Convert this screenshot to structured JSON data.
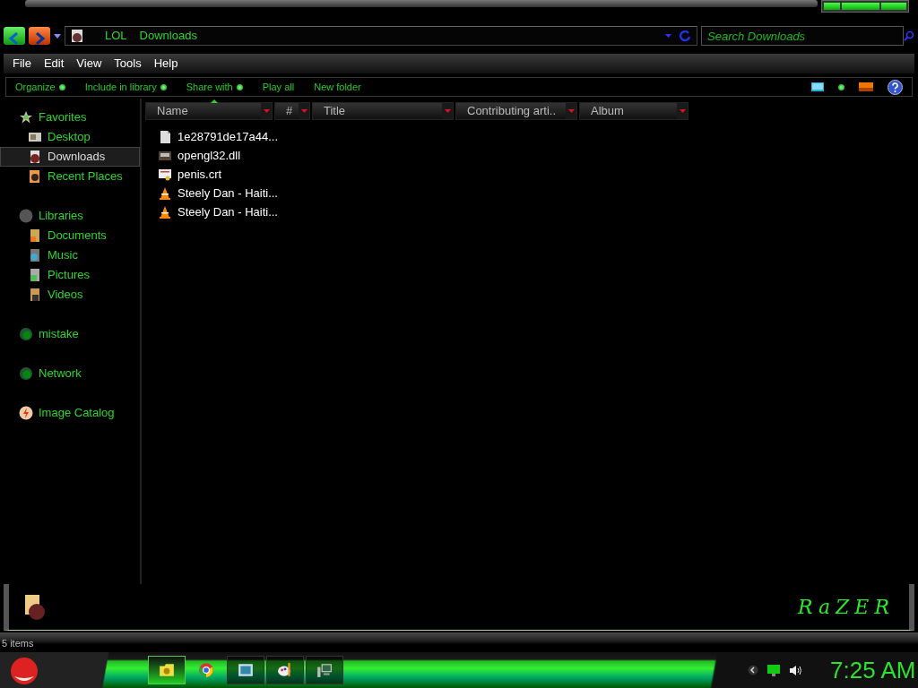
{
  "nav": {
    "path": [
      "LOL",
      "Downloads"
    ],
    "search": {
      "placeholder": "Search Downloads"
    }
  },
  "menu": [
    "File",
    "Edit",
    "View",
    "Tools",
    "Help"
  ],
  "commands": [
    {
      "label": "Organize",
      "dropdown": true
    },
    {
      "label": "Include in library",
      "dropdown": true
    },
    {
      "label": "Share with",
      "dropdown": true
    },
    {
      "label": "Play all",
      "dropdown": false
    },
    {
      "label": "New folder",
      "dropdown": false
    }
  ],
  "columns": [
    {
      "label": "Name",
      "sorted": true
    },
    {
      "label": "#",
      "sorted": false
    },
    {
      "label": "Title",
      "sorted": false
    },
    {
      "label": "Contributing arti..",
      "sorted": false
    },
    {
      "label": "Album",
      "sorted": false
    }
  ],
  "sidebar": [
    {
      "label": "Favorites",
      "selected": false,
      "children": [
        {
          "label": "Desktop",
          "selected": false
        },
        {
          "label": "Downloads",
          "selected": true
        },
        {
          "label": "Recent Places",
          "selected": false
        }
      ]
    },
    {
      "label": "Libraries",
      "selected": false,
      "children": [
        {
          "label": "Documents",
          "selected": false
        },
        {
          "label": "Music",
          "selected": false
        },
        {
          "label": "Pictures",
          "selected": false
        },
        {
          "label": "Videos",
          "selected": false
        }
      ]
    },
    {
      "label": "mistake",
      "selected": false
    },
    {
      "label": "Network",
      "selected": false
    },
    {
      "label": "Image Catalog",
      "selected": false
    }
  ],
  "files": [
    {
      "name": "1e28791de17a44...",
      "kind": "file"
    },
    {
      "name": "opengl32.dll",
      "kind": "dll"
    },
    {
      "name": "penis.crt",
      "kind": "cert"
    },
    {
      "name": "Steely Dan - Haiti...",
      "kind": "media"
    },
    {
      "name": "Steely Dan - Haiti...",
      "kind": "media"
    }
  ],
  "details": {
    "logo": "RaZER"
  },
  "status_bar": "5 items",
  "taskbar": {
    "apps": [
      {
        "kind": "folder",
        "active": true,
        "open": true
      },
      {
        "kind": "browser",
        "active": false,
        "open": false
      },
      {
        "kind": "picture",
        "active": false,
        "open": true
      },
      {
        "kind": "paint",
        "active": false,
        "open": true
      },
      {
        "kind": "computer",
        "active": false,
        "open": true
      }
    ],
    "clock": "7:25 AM"
  }
}
